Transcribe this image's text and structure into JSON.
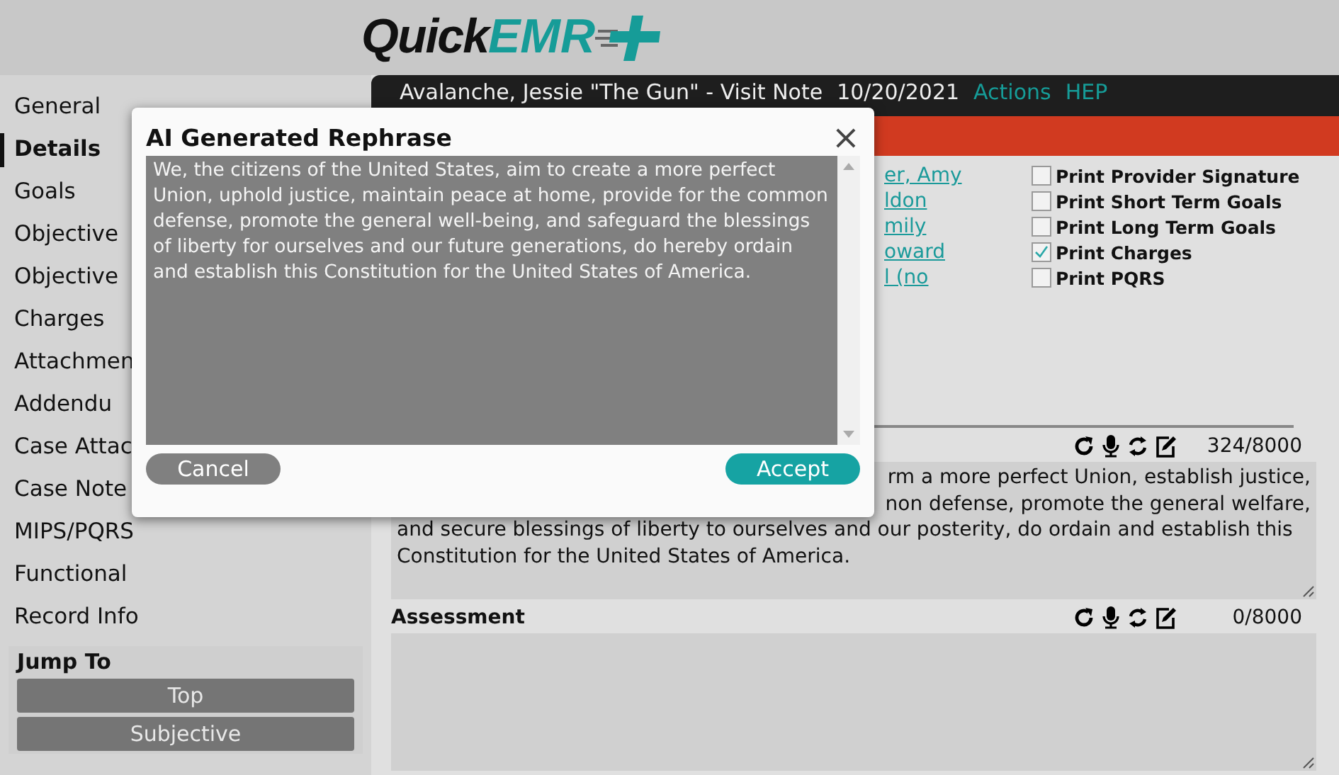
{
  "logo": {
    "part_1": "Quick",
    "part_2": "EMR"
  },
  "sidebar": {
    "items": [
      {
        "label": "General",
        "selected": false
      },
      {
        "label": "Details",
        "selected": true
      },
      {
        "label": "Goals",
        "selected": false
      },
      {
        "label": "Objective",
        "selected": false
      },
      {
        "label": "Objective",
        "selected": false
      },
      {
        "label": "Charges",
        "selected": false
      },
      {
        "label": "Attachmen",
        "selected": false
      },
      {
        "label": "Addendu",
        "selected": false
      },
      {
        "label": "Case Attac",
        "selected": false
      },
      {
        "label": "Case Note",
        "selected": false
      },
      {
        "label": "MIPS/PQRS",
        "selected": false
      },
      {
        "label": "Functional",
        "selected": false
      },
      {
        "label": "Record Info",
        "selected": false
      }
    ],
    "jump_to": {
      "title": "Jump To",
      "buttons": [
        "Top",
        "Subjective"
      ]
    }
  },
  "header": {
    "title": "Avalanche, Jessie \"The Gun\" - Visit Note",
    "date": "10/20/2021",
    "links": [
      "Actions",
      "HEP"
    ]
  },
  "details": {
    "links": [
      "er, Amy",
      "ldon",
      "mily",
      "oward",
      "l (no"
    ],
    "print_options": [
      {
        "label": "Print Provider Signature",
        "checked": false
      },
      {
        "label": "Print Short Term Goals",
        "checked": false
      },
      {
        "label": "Print Long Term Goals",
        "checked": false
      },
      {
        "label": "Print Charges",
        "checked": true
      },
      {
        "label": "Print PQRS",
        "checked": false
      }
    ]
  },
  "sections": [
    {
      "counter": "324/8000",
      "lines": [
        {
          "text": "rm a more perfect Union, establish justice,",
          "covered": true
        },
        {
          "text": "non defense, promote the general welfare,",
          "covered": true
        },
        {
          "text": "and secure blessings of liberty to ourselves and our posterity, do ordain and establish this",
          "covered": false
        },
        {
          "text": "Constitution for the United States of America.",
          "covered": false
        }
      ]
    },
    {
      "title": "Assessment",
      "counter": "0/8000"
    }
  ],
  "dialog": {
    "title": "AI Generated Rephrase",
    "close": "×",
    "text": "We, the citizens of the United States, aim to create a more perfect Union, uphold justice, maintain peace at home, provide for the common defense, promote the general well-being, and safeguard the blessings of liberty for ourselves and our future generations, do hereby ordain and establish this Constitution for the United States of America.",
    "cancel": "Cancel",
    "accept": "Accept"
  }
}
